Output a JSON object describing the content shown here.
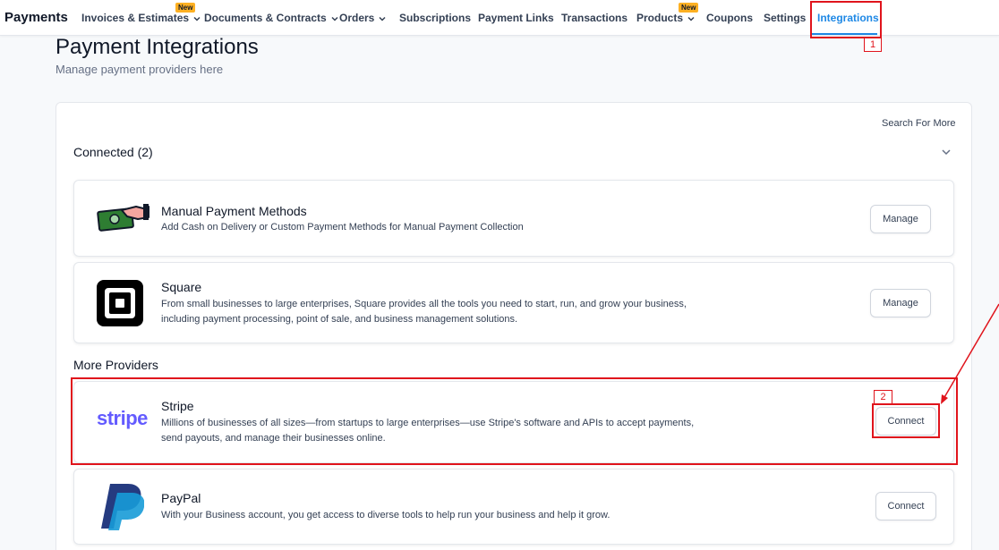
{
  "nav": {
    "brand": "Payments",
    "items": [
      {
        "label": "Invoices & Estimates",
        "badge": "New"
      },
      {
        "label": "Documents & Contracts"
      },
      {
        "label": "Orders"
      },
      {
        "label": "Subscriptions"
      },
      {
        "label": "Payment Links"
      },
      {
        "label": "Transactions"
      },
      {
        "label": "Products",
        "badge": "New"
      },
      {
        "label": "Coupons"
      },
      {
        "label": "Settings"
      },
      {
        "label": "Integrations",
        "active": true
      }
    ]
  },
  "page": {
    "title": "Payment Integrations",
    "subtitle": "Manage payment providers here"
  },
  "search_more": "Search For More",
  "connected": {
    "title": "Connected (2)",
    "providers": [
      {
        "name": "Manual Payment Methods",
        "description": "Add Cash on Delivery or Custom Payment Methods for Manual Payment Collection",
        "action": "Manage",
        "logo": "cash-hand-icon"
      },
      {
        "name": "Square",
        "description": "From small businesses to large enterprises, Square provides all the tools you need to start, run, and grow your business, including payment processing, point of sale, and business management solutions.",
        "action": "Manage",
        "logo": "square-logo-icon"
      }
    ]
  },
  "more": {
    "title": "More Providers",
    "providers": [
      {
        "name": "Stripe",
        "description": "Millions of businesses of all sizes—from startups to large enterprises—use Stripe's software and APIs to accept payments, send payouts, and manage their businesses online.",
        "action": "Connect",
        "logo_text": "stripe"
      },
      {
        "name": "PayPal",
        "description": "With your Business account, you get access to diverse tools to help run your business and help it grow.",
        "action": "Connect",
        "logo": "paypal-logo-icon"
      }
    ]
  },
  "annotations": {
    "one": "1",
    "two": "2"
  },
  "colors": {
    "accent": "#1e88e5",
    "annotation": "#e0141c",
    "badge": "#fdb022",
    "stripe": "#635bff",
    "paypal_dark": "#253b80",
    "paypal_light": "#179bd7"
  }
}
